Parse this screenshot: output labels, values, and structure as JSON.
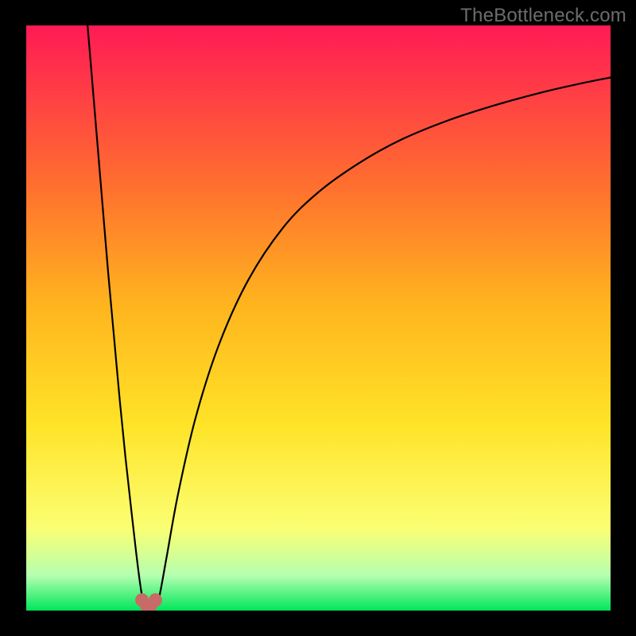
{
  "watermark": "TheBottleneck.com",
  "colors": {
    "top": "#ff1a55",
    "mid1": "#ff6e2f",
    "mid2": "#ffb51e",
    "mid3": "#ffe327",
    "mid4": "#fbff73",
    "mid5": "#b5ffb0",
    "bottom": "#00e65b",
    "curve": "#000000",
    "marker": "#c86a68",
    "frame": "#000000"
  },
  "chart_data": {
    "type": "line",
    "title": "",
    "xlabel": "",
    "ylabel": "",
    "xlim": [
      0,
      100
    ],
    "ylim": [
      0,
      100
    ],
    "grid": false,
    "legend": false,
    "annotations": [
      "TheBottleneck.com"
    ],
    "series": [
      {
        "name": "bottleneck-curve-left",
        "x": [
          10.5,
          11,
          12,
          13,
          14,
          15,
          16,
          17,
          18,
          18.8,
          19.5,
          20,
          20.3
        ],
        "y": [
          100,
          94,
          82,
          70,
          58,
          47,
          36,
          26,
          17,
          10,
          4.5,
          1.6,
          0.9
        ]
      },
      {
        "name": "bottleneck-curve-right",
        "x": [
          22.2,
          22.8,
          24,
          26,
          29,
          33,
          38,
          44,
          50,
          57,
          64,
          72,
          80,
          88,
          95,
          100
        ],
        "y": [
          0.9,
          2.5,
          9,
          20,
          33,
          45.5,
          56.5,
          65.5,
          71.5,
          76.5,
          80.4,
          83.7,
          86.3,
          88.5,
          90.1,
          91.1
        ]
      }
    ],
    "markers": {
      "name": "minimum-region",
      "x": [
        19.8,
        20.6,
        21.3,
        22.1
      ],
      "y": [
        1.8,
        0.9,
        0.9,
        1.8
      ]
    }
  }
}
